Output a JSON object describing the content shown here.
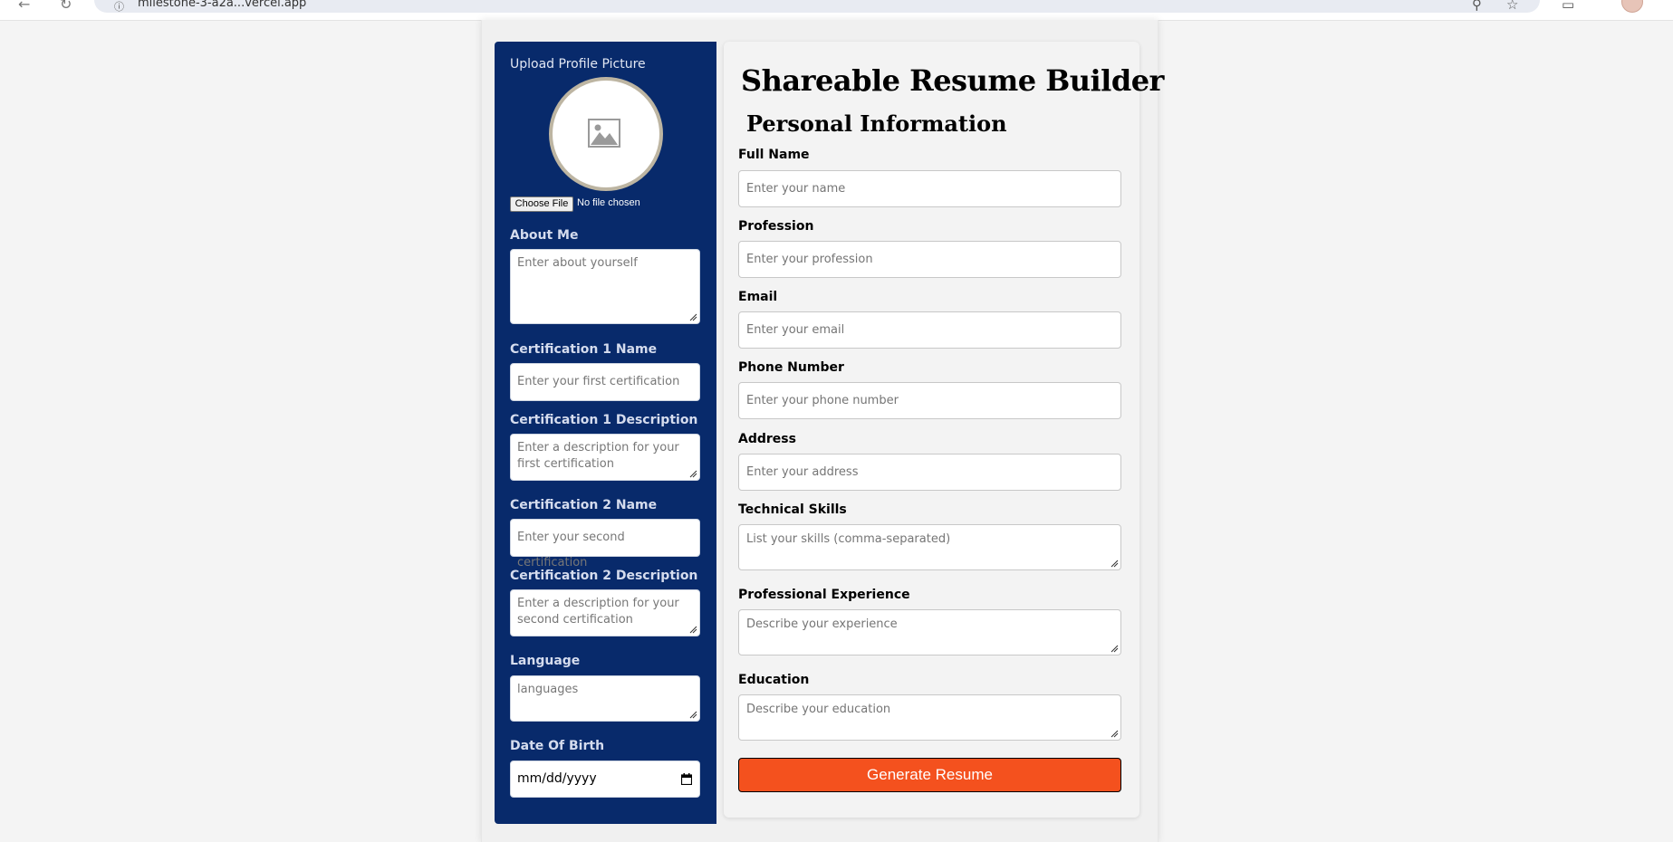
{
  "browser": {
    "url": "milestone-3-a2a...vercel.app",
    "back_glyph": "←",
    "reload_glyph": "↻",
    "site_info_glyph": "ⓘ",
    "zoom_glyph": "⚲",
    "bookmark_glyph": "☆",
    "tabs_glyph": "▭"
  },
  "sidebar": {
    "upload_label": "Upload Profile Picture",
    "file_button_label": "Choose File",
    "file_status": "No file chosen",
    "about_label": "About Me",
    "about_placeholder": "Enter about yourself",
    "cert1_name_label": "Certification 1 Name",
    "cert1_name_placeholder": "Enter your first certification",
    "cert1_desc_label": "Certification 1 Description",
    "cert1_desc_placeholder": "Enter a description for your first certification",
    "cert2_name_label": "Certification 2 Name",
    "cert2_name_placeholder": "Enter your second certification",
    "cert2_desc_label": "Certification 2 Description",
    "cert2_desc_placeholder": "Enter a description for your second certification",
    "language_label": "Language",
    "language_placeholder": "languages",
    "dob_label": "Date Of Birth",
    "dob_placeholder": "mm/dd/yyyy"
  },
  "main": {
    "title": "Shareable Resume Builder",
    "section_title": "Personal Information",
    "full_name_label": "Full Name",
    "full_name_placeholder": "Enter your name",
    "profession_label": "Profession",
    "profession_placeholder": "Enter your profession",
    "email_label": "Email",
    "email_placeholder": "Enter your email",
    "phone_label": "Phone Number",
    "phone_placeholder": "Enter your phone number",
    "address_label": "Address",
    "address_placeholder": "Enter your address",
    "skills_label": "Technical Skills",
    "skills_placeholder": "List your skills (comma-separated)",
    "experience_label": "Professional Experience",
    "experience_placeholder": "Describe your experience",
    "education_label": "Education",
    "education_placeholder": "Describe your education",
    "generate_label": "Generate Resume"
  },
  "colors": {
    "sidebar_bg": "#082a6b",
    "generate_button": "#f4511e",
    "page_bg": "#f4f4f4"
  }
}
